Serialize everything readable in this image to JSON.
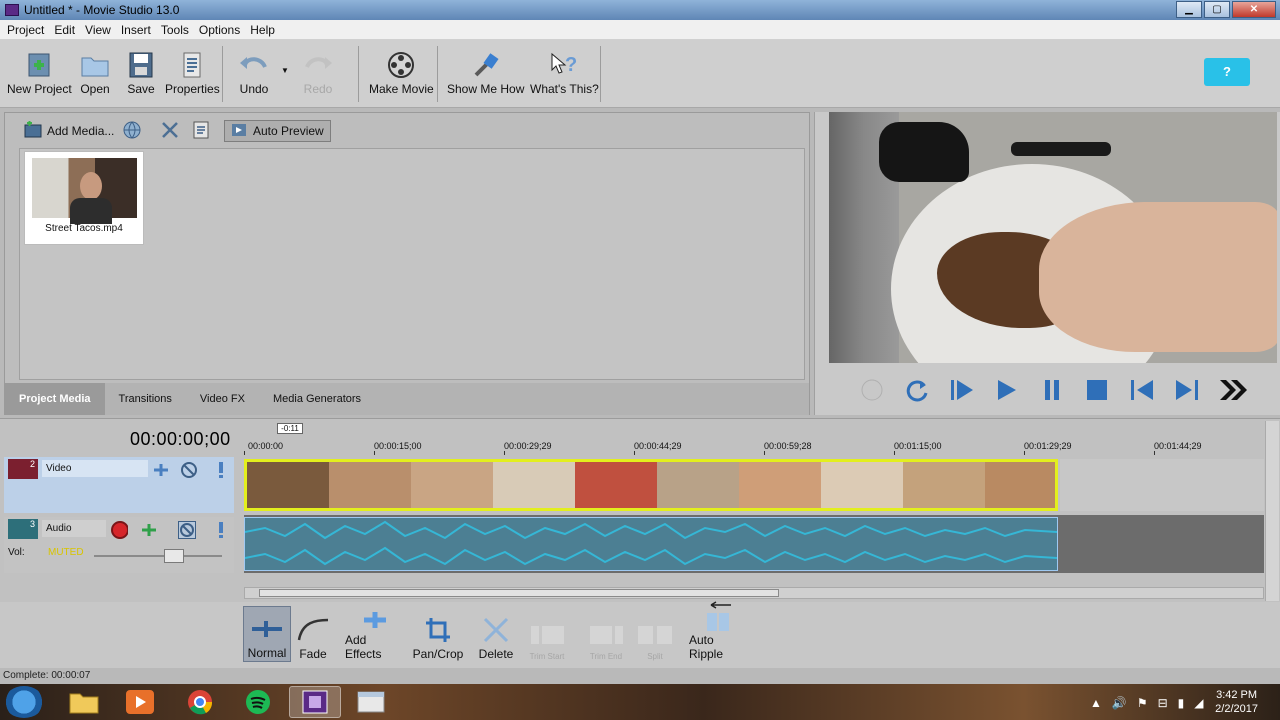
{
  "window": {
    "title": "Untitled * - Movie Studio 13.0"
  },
  "menu": [
    "Project",
    "Edit",
    "View",
    "Insert",
    "Tools",
    "Options",
    "Help"
  ],
  "toolbar": {
    "new_project": "New Project",
    "open": "Open",
    "save": "Save",
    "properties": "Properties",
    "undo": "Undo",
    "redo": "Redo",
    "make_movie": "Make Movie",
    "show_me_how": "Show Me How",
    "whats_this": "What's This?",
    "help_bubble": "?"
  },
  "media": {
    "add_media": "Add Media...",
    "auto_preview": "Auto Preview",
    "file_name": "Street Tacos.mp4",
    "tabs": [
      "Project Media",
      "Transitions",
      "Video FX",
      "Media Generators"
    ],
    "active_tab": "Project Media"
  },
  "timeline": {
    "timecode": "00:00:00;00",
    "cursor_label": "-0:11",
    "ruler_labels": [
      "00:00:00",
      "00:00:15;00",
      "00:00:29;29",
      "00:00:44;29",
      "00:00:59;28",
      "00:01:15;00",
      "00:01:29;29",
      "00:01:44;29"
    ],
    "video_track": {
      "number": "2",
      "name": "Video"
    },
    "audio_track": {
      "number": "3",
      "name": "Audio",
      "vol_label": "Vol:",
      "muted_label": "MUTED"
    }
  },
  "editbar": {
    "normal": "Normal",
    "fade": "Fade",
    "add_effects": "Add Effects",
    "pan_crop": "Pan/Crop",
    "delete": "Delete",
    "trim_start": "Trim Start",
    "trim_end": "Trim End",
    "split": "Split",
    "auto_ripple": "Auto Ripple"
  },
  "status": {
    "text": "Complete: 00:00:07"
  },
  "taskbar": {
    "time": "3:42 PM",
    "date": "2/2/2017"
  },
  "colors": {
    "video_track_border": "#e3ef1d",
    "audio_wave": "#35b7d6",
    "help_bubble": "#29c1e8"
  }
}
